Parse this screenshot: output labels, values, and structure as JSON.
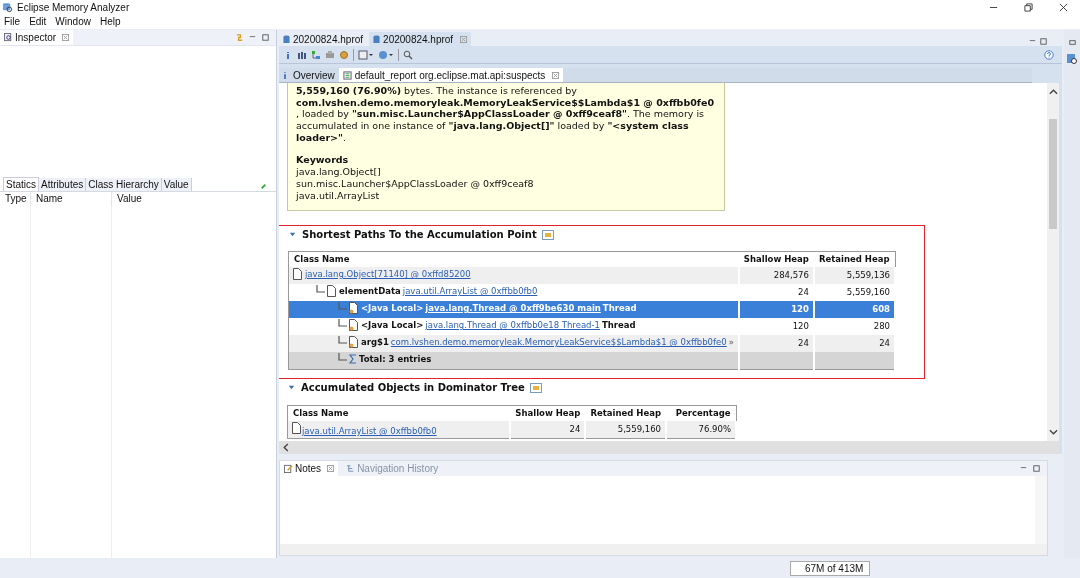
{
  "window": {
    "title": "Eclipse Memory Analyzer"
  },
  "menu": [
    "File",
    "Edit",
    "Window",
    "Help"
  ],
  "inspector": {
    "title": "Inspector",
    "tabs": [
      {
        "label": "Statics",
        "selected": true
      },
      {
        "label": "Attributes",
        "selected": false
      },
      {
        "label": "Class Hierarchy",
        "selected": false
      },
      {
        "label": "Value",
        "selected": false
      }
    ],
    "columns": [
      "Type",
      "Name",
      "Value"
    ]
  },
  "editor": {
    "tabs": [
      {
        "label": "20200824.hprof",
        "selected": false
      },
      {
        "label": "20200824.hprof",
        "selected": true
      }
    ],
    "subtabs": [
      {
        "label": "Overview",
        "selected": false
      },
      {
        "label": "default_report  org.eclipse.mat.api:suspects",
        "selected": true
      }
    ],
    "description": "**5,559,160 (76.90%)** bytes. The instance is referenced by **com.lvshen.demo.memoryleak.MemoryLeakService$$Lambda$1 @ 0xffbb0fe0** , loaded by **\"sun.misc.Launcher$AppClassLoader @ 0xff9ceaf8\"**. The memory is accumulated in one instance of **\"java.lang.Object[]\"** loaded by **\"<system class loader>\"**.",
    "keywords_title": "Keywords",
    "keywords": [
      "java.lang.Object[]",
      "sun.misc.Launcher$AppClassLoader @ 0xff9ceaf8",
      "java.util.ArrayList"
    ],
    "paths": {
      "title": "Shortest Paths To the Accumulation Point",
      "expanded": true,
      "highlighted": true,
      "columns": [
        "Class Name",
        "Shallow Heap",
        "Retained Heap"
      ],
      "rows": [
        {
          "kind": "object",
          "link": "java.lang.Object[71140] @ 0xffd85200",
          "shallow": "284,576",
          "retained": "5,559,136",
          "selected": false,
          "children": [
            {
              "kind": "object",
              "label": "elementData",
              "link": "java.util.ArrayList @ 0xffbb0fb0",
              "shallow": "24",
              "retained": "5,559,160",
              "selected": false,
              "children": [
                {
                  "kind": "object",
                  "label": "<Java Local>",
                  "link": "java.lang.Thread @ 0xff9be630 main",
                  "suffix": "Thread",
                  "shallow": "120",
                  "retained": "608",
                  "selected": true
                },
                {
                  "kind": "object",
                  "label": "<Java Local>",
                  "link": "java.lang.Thread @ 0xffbb0e18 Thread-1",
                  "suffix": "Thread",
                  "shallow": "120",
                  "retained": "280",
                  "selected": false
                },
                {
                  "kind": "object",
                  "label": "arg$1",
                  "link": "com.lvshen.demo.memoryleak.MemoryLeakService$$Lambda$1 @ 0xffbb0fe0",
                  "more": "»",
                  "shallow": "24",
                  "retained": "24",
                  "selected": false
                },
                {
                  "kind": "total",
                  "label": "Total: 3 entries",
                  "selected": false
                }
              ]
            }
          ]
        }
      ]
    },
    "dominator": {
      "title": "Accumulated Objects in Dominator Tree",
      "expanded": true,
      "columns": [
        "Class Name",
        "Shallow Heap",
        "Retained Heap",
        "Percentage"
      ],
      "rows": [
        {
          "link": "java.util.ArrayList @ 0xffbb0fb0",
          "shallow": "24",
          "retained": "5,559,160",
          "percentage": "76.90%"
        }
      ]
    }
  },
  "notes": {
    "tabs": [
      {
        "label": "Notes",
        "selected": true
      },
      {
        "label": "Navigation History",
        "selected": false
      }
    ]
  },
  "status_bar": {
    "memory": "67M of 413M"
  }
}
